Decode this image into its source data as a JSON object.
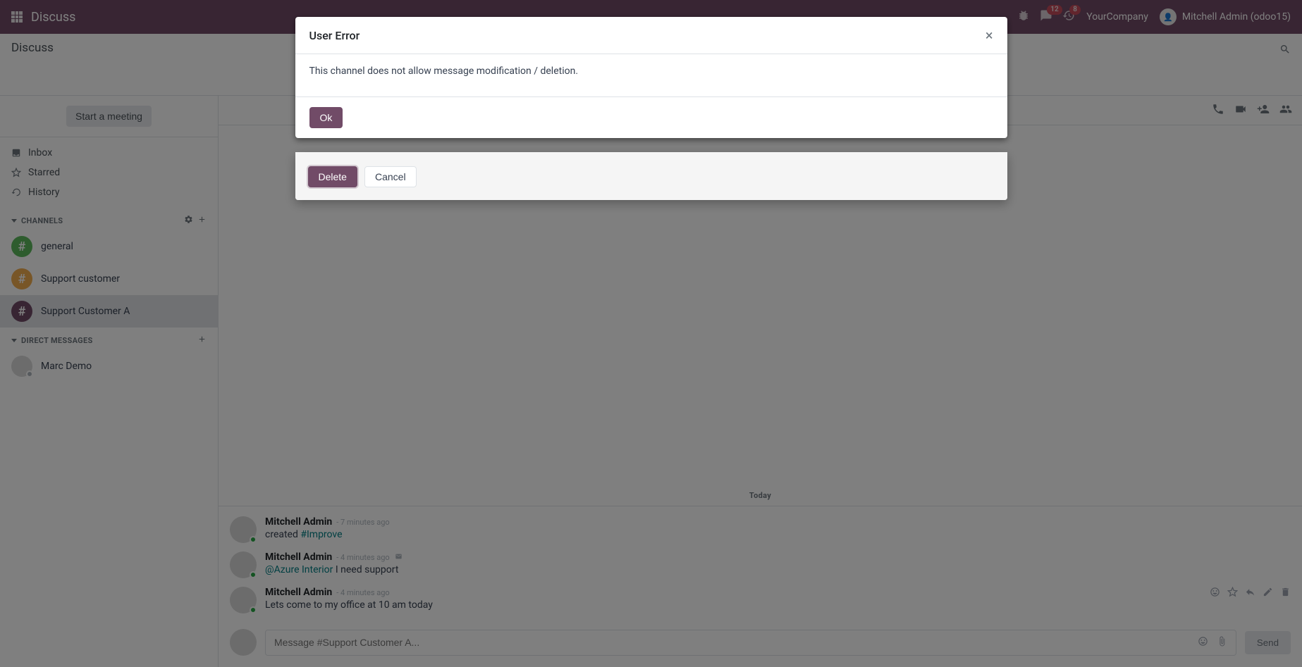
{
  "navbar": {
    "app_title": "Discuss",
    "msg_badge": "12",
    "call_badge": "8",
    "company": "YourCompany",
    "user_name": "Mitchell Admin (odoo15)"
  },
  "control_panel": {
    "breadcrumb": "Discuss"
  },
  "sidebar": {
    "start_meeting": "Start a meeting",
    "inbox": "Inbox",
    "starred": "Starred",
    "history": "History",
    "channels_header": "CHANNELS",
    "channels": [
      {
        "label": "general",
        "color": "ch-green"
      },
      {
        "label": "Support customer",
        "color": "ch-orange"
      },
      {
        "label": "Support Customer A",
        "color": "ch-purple"
      }
    ],
    "dm_header": "DIRECT MESSAGES",
    "dms": [
      {
        "label": "Marc Demo"
      }
    ]
  },
  "chat": {
    "date_separator": "Today",
    "messages": [
      {
        "author": "Mitchell Admin",
        "time": "7 minutes ago",
        "content_prefix": "created ",
        "content_link": "#Improve",
        "content_suffix": "",
        "envelope": false
      },
      {
        "author": "Mitchell Admin",
        "time": "4 minutes ago",
        "content_prefix": "",
        "content_link": "@Azure Interior",
        "content_suffix": " I need support",
        "envelope": true
      },
      {
        "author": "Mitchell Admin",
        "time": "4 minutes ago",
        "content_prefix": "Lets come to my office at 10 am today",
        "content_link": "",
        "content_suffix": "",
        "envelope": false
      }
    ],
    "composer_placeholder": "Message #Support Customer A...",
    "send": "Send"
  },
  "modal_behind": {
    "delete": "Delete",
    "cancel": "Cancel"
  },
  "modal_front": {
    "title": "User Error",
    "body": "This channel does not allow message modification / deletion.",
    "ok": "Ok"
  }
}
